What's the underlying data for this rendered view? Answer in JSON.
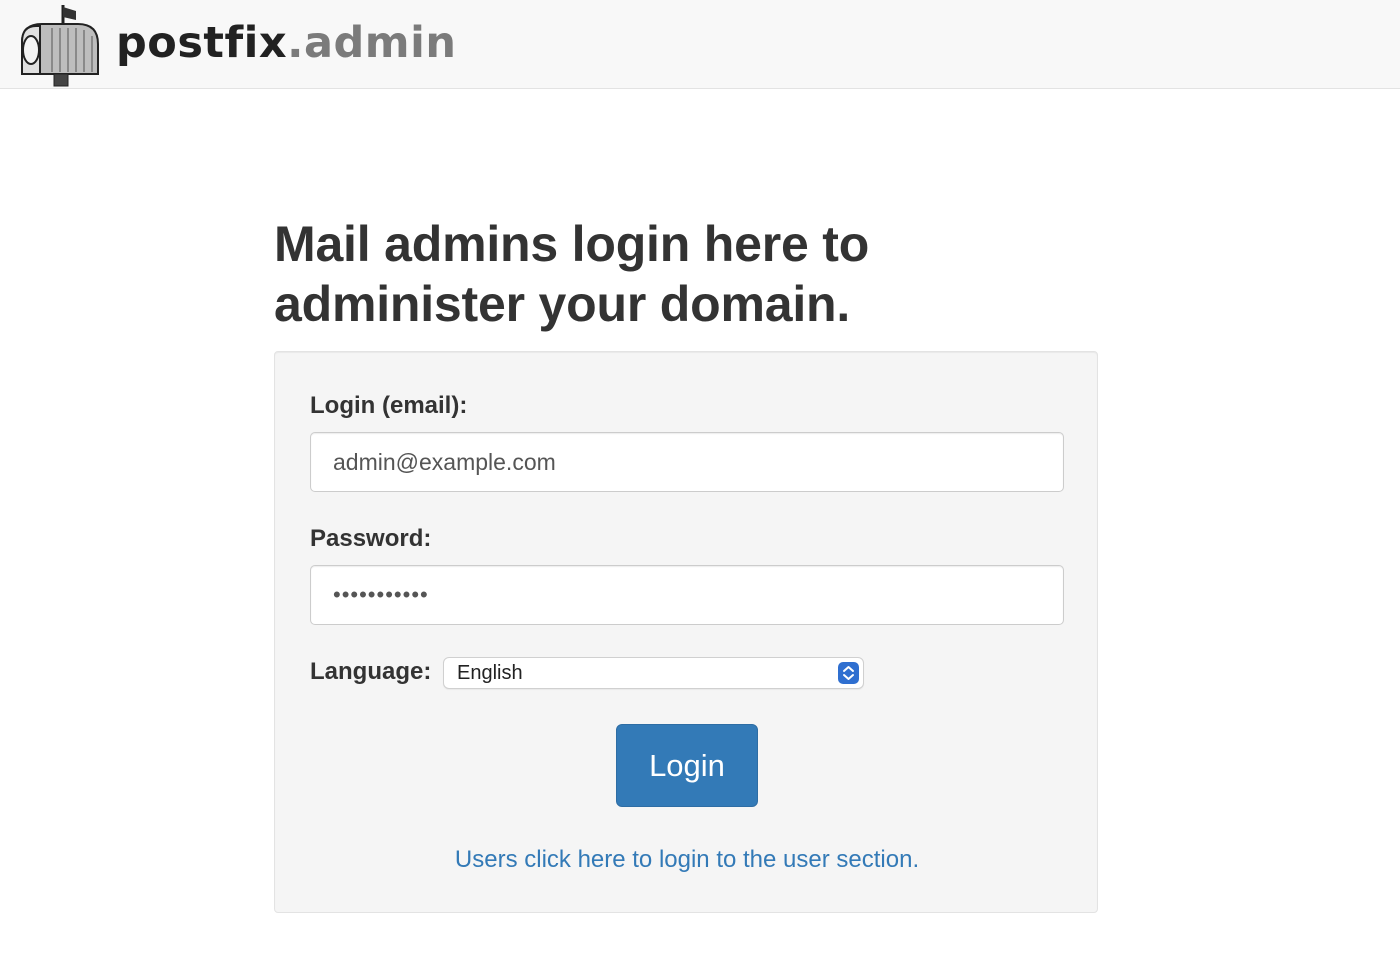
{
  "header": {
    "brand_part1": "postfix",
    "brand_part2": ".admin",
    "logo_icon": "mailbox-icon"
  },
  "main": {
    "heading": "Mail admins login here to administer your domain."
  },
  "form": {
    "login_label": "Login (email):",
    "login_value": "admin@example.com",
    "password_label": "Password:",
    "password_value": "•••••••••••",
    "language_label": "Language:",
    "language_selected": "English",
    "submit_label": "Login",
    "user_link": "Users click here to login to the user section."
  },
  "colors": {
    "accent": "#337ab7",
    "panel_bg": "#f5f5f5",
    "header_bg": "#f8f8f8",
    "select_arrow": "#2f6fd0"
  }
}
